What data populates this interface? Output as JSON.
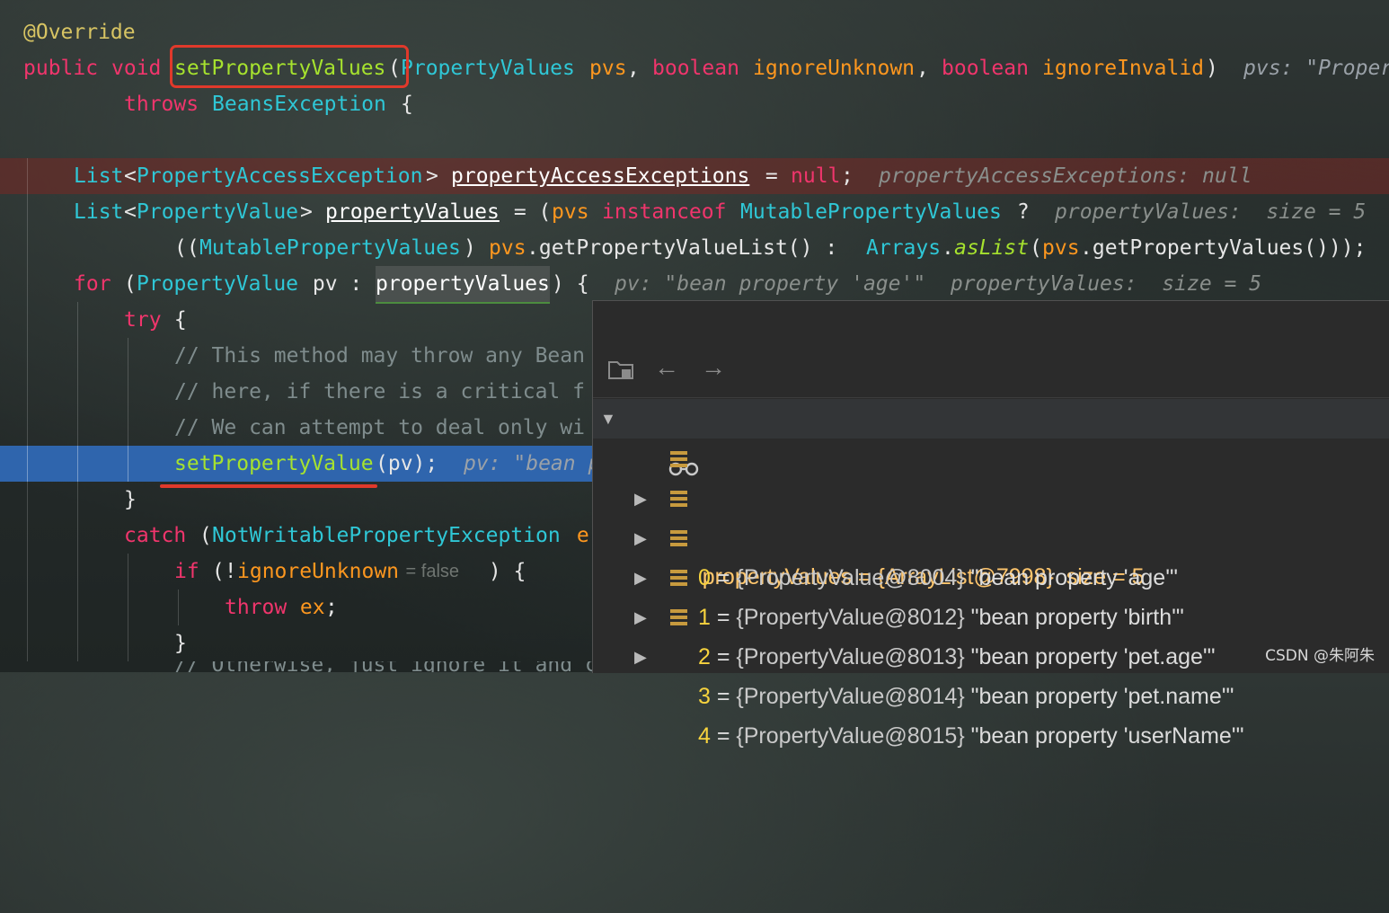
{
  "editor": {
    "lines": [
      {
        "annotation": "@Override"
      },
      {
        "kw_public": "public",
        "kw_void": "void",
        "method": "setPropertyValues",
        "paren_open": "(",
        "type_pv": "PropertyValues",
        "param_pvs": "pvs",
        "comma1": ",",
        "kw_boolean1": "boolean",
        "param_ignore_unknown": "ignoreUnknown",
        "comma2": ",",
        "kw_boolean2": "boolean",
        "param_ignore_invalid": "ignoreInvalid",
        "paren_close": ")",
        "hint": "pvs: \"Proper"
      },
      {
        "kw_throws": "throws",
        "type_exc": "BeansException",
        "brace": "{"
      },
      {},
      {
        "type_list": "List",
        "lt": "<",
        "type_pae": "PropertyAccessException",
        "gt": ">",
        "var": "propertyAccessExceptions",
        "assign": " = ",
        "kw_null": "null",
        "semi": ";",
        "hint": "propertyAccessExceptions: null"
      },
      {
        "type_list": "List",
        "lt": "<",
        "type_pv": "PropertyValue",
        "gt": ">",
        "var": "propertyValues",
        "assign": " = (",
        "param_pvs": "pvs",
        "kw_instanceof": "instanceof",
        "type_mpv": "MutablePropertyValues",
        "q": " ?",
        "hint": "propertyValues:  size = 5"
      },
      {
        "open": "((",
        "type_mpv": "MutablePropertyValues",
        "close": ") ",
        "param_pvs": "pvs",
        "call1": ".getPropertyValueList() : ",
        "type_arrays": "Arrays",
        "dot": ".",
        "method_aslist": "asList",
        "po": "(",
        "param_pvs2": "pvs",
        "call2": ".getPropertyValues()));"
      },
      {
        "kw_for": "for",
        "open": " (",
        "type_pv": "PropertyValue",
        "pv": " pv : ",
        "var": "propertyValues",
        "close": ") {",
        "hint": "pv: \"bean property 'age'\"  propertyValues:  size = 5"
      },
      {
        "kw_try": "try",
        "brace": " {"
      },
      {
        "comment": "// This method may throw any Bean"
      },
      {
        "comment": "// here, if there is a critical f"
      },
      {
        "comment": "// We can attempt to deal only wi"
      },
      {
        "method": "setPropertyValue",
        "args": "(pv);",
        "hint": "pv: \"bean p"
      },
      {
        "brace": "}"
      },
      {
        "kw_catch": "catch",
        "open": " (",
        "type_ex": "NotWritablePropertyException",
        "tail": " e"
      },
      {
        "kw_if": "if",
        "open": " (!",
        "param": "ignoreUnknown",
        "hint": " = false",
        "close": " ) {"
      },
      {
        "kw_throw": "throw",
        "var": " ex",
        "semi": ";"
      },
      {
        "brace": "}"
      },
      {
        "comment": "// Otherwise, just ignore it and c"
      }
    ]
  },
  "debug_popup": {
    "toolbar": {
      "icons": [
        "watch-folder-icon",
        "back-arrow-icon",
        "forward-arrow-icon"
      ],
      "back": "←",
      "forward": "→"
    },
    "root": {
      "name": "propertyValues",
      "eq": " = ",
      "value": "{ArrayList@7998}",
      "size": "size = 5"
    },
    "children": [
      {
        "index": "0",
        "eq": " = ",
        "ref": "{PropertyValue@8004}",
        "desc": "\"bean property 'age'\""
      },
      {
        "index": "1",
        "eq": " = ",
        "ref": "{PropertyValue@8012}",
        "desc": "\"bean property 'birth'\""
      },
      {
        "index": "2",
        "eq": " = ",
        "ref": "{PropertyValue@8013}",
        "desc": "\"bean property 'pet.age'\""
      },
      {
        "index": "3",
        "eq": " = ",
        "ref": "{PropertyValue@8014}",
        "desc": "\"bean property 'pet.name'\""
      },
      {
        "index": "4",
        "eq": " = ",
        "ref": "{PropertyValue@8015}",
        "desc": "\"bean property 'userName'\""
      }
    ]
  },
  "watermark": "CSDN @朱阿朱",
  "colors": {
    "keyword": "#f0356c",
    "type": "#2fc7d6",
    "method": "#a6e22e",
    "param": "#fd971f",
    "annotation": "#d7c463",
    "exec_line": "#2f65ad",
    "highlight_box": "#e0392b"
  }
}
